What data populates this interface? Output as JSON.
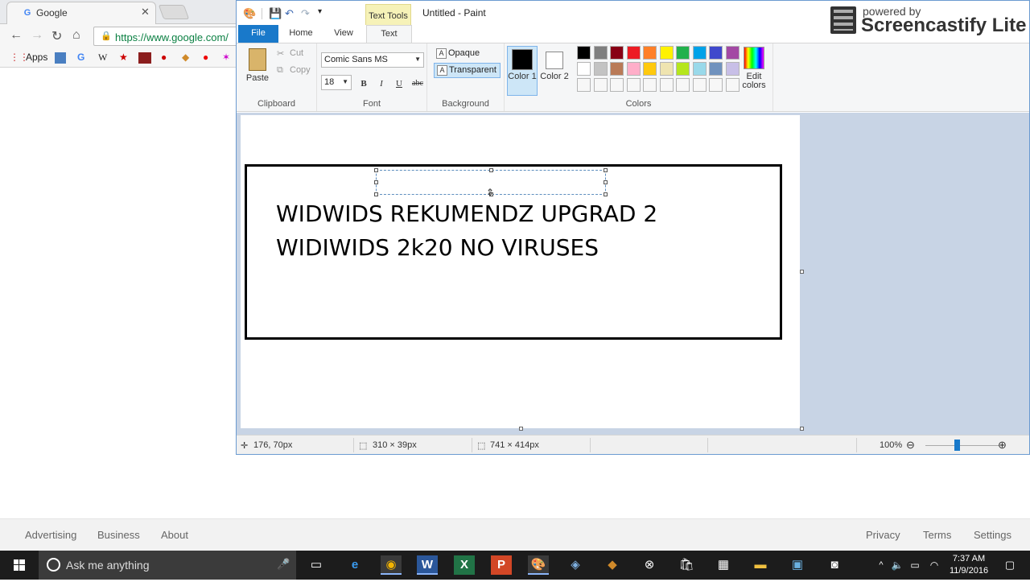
{
  "chrome": {
    "tab_title": "Google",
    "tab_favicon": "G",
    "url": "https://www.google.com/",
    "bookmarks": [
      {
        "label": "Apps",
        "icon": "apps-grid-icon"
      },
      {
        "label": "",
        "icon": "bookmark-icon-1"
      },
      {
        "label": "G",
        "icon": "google-icon"
      },
      {
        "label": "W",
        "icon": "wikipedia-icon"
      }
    ],
    "footer_left": [
      "Advertising",
      "Business",
      "About"
    ],
    "footer_right": [
      "Privacy",
      "Terms",
      "Settings"
    ]
  },
  "paint": {
    "context_tab": "Text Tools",
    "window_title": "Untitled - Paint",
    "tabs": [
      "File",
      "Home",
      "View",
      "Text"
    ],
    "clipboard": {
      "paste": "Paste",
      "cut": "Cut",
      "copy": "Copy",
      "label": "Clipboard"
    },
    "font": {
      "family": "Comic Sans MS",
      "size": "18",
      "bold": "B",
      "italic": "I",
      "underline": "U",
      "strike": "abc",
      "label": "Font"
    },
    "background": {
      "opaque": "Opaque",
      "transparent": "Transparent",
      "label": "Background"
    },
    "colors": {
      "color1_label": "Color 1",
      "color2_label": "Color 2",
      "edit_label": "Edit colors",
      "label": "Colors",
      "color1": "#000000",
      "color2": "#ffffff",
      "palette_row1": [
        "#000000",
        "#7f7f7f",
        "#880015",
        "#ed1c24",
        "#ff7f27",
        "#fff200",
        "#22b14c",
        "#00a2e8",
        "#3f48cc",
        "#a349a4"
      ],
      "palette_row2": [
        "#ffffff",
        "#c3c3c3",
        "#b97a57",
        "#ffaec9",
        "#ffc90e",
        "#efe4b0",
        "#b5e61d",
        "#99d9ea",
        "#7092be",
        "#c8bfe7"
      ]
    },
    "canvas_text": [
      "WIDWIDS REKUMENDZ UPGRAD 2",
      "WIDIWIDS 2k20 NO VIRUSES"
    ],
    "status": {
      "cursor": "176, 70px",
      "selection": "310 × 39px",
      "canvas": "741 × 414px",
      "zoom": "100%"
    }
  },
  "watermark": {
    "small": "powered by",
    "big": "Screencastify Lite"
  },
  "taskbar": {
    "search": "Ask me anything",
    "time": "7:37 AM",
    "date": "11/9/2016"
  }
}
